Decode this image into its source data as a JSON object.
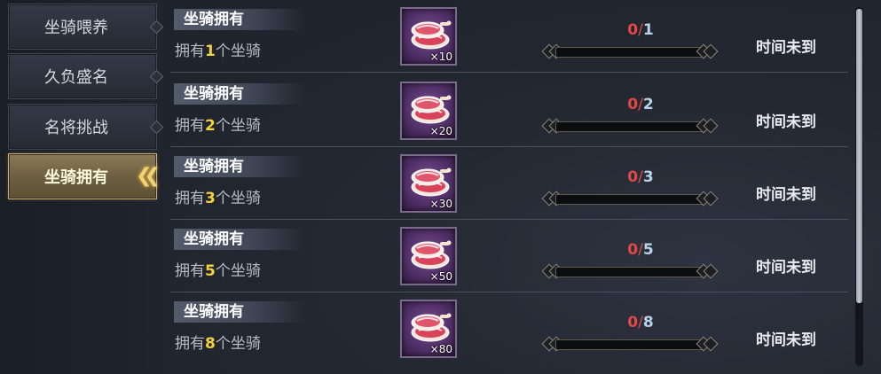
{
  "sidebar": {
    "tabs": [
      {
        "label": "坐骑喂养",
        "active": false
      },
      {
        "label": "久负盛名",
        "active": false
      },
      {
        "label": "名将挑战",
        "active": false
      },
      {
        "label": "坐骑拥有",
        "active": true
      }
    ],
    "active_indicator_icon": "double-chevron-left-icon"
  },
  "tasks": [
    {
      "title": "坐骑拥有",
      "desc_prefix": "拥有",
      "desc_num": "1",
      "desc_suffix": "个坐骑",
      "reward_icon": "meat-icon",
      "reward_qty": "×10",
      "progress_current": "0",
      "progress_sep": "/",
      "progress_total": "1",
      "progress_fraction": 0,
      "status": "时间未到"
    },
    {
      "title": "坐骑拥有",
      "desc_prefix": "拥有",
      "desc_num": "2",
      "desc_suffix": "个坐骑",
      "reward_icon": "meat-icon",
      "reward_qty": "×20",
      "progress_current": "0",
      "progress_sep": "/",
      "progress_total": "2",
      "progress_fraction": 0,
      "status": "时间未到"
    },
    {
      "title": "坐骑拥有",
      "desc_prefix": "拥有",
      "desc_num": "3",
      "desc_suffix": "个坐骑",
      "reward_icon": "meat-icon",
      "reward_qty": "×30",
      "progress_current": "0",
      "progress_sep": "/",
      "progress_total": "3",
      "progress_fraction": 0,
      "status": "时间未到"
    },
    {
      "title": "坐骑拥有",
      "desc_prefix": "拥有",
      "desc_num": "5",
      "desc_suffix": "个坐骑",
      "reward_icon": "meat-icon",
      "reward_qty": "×50",
      "progress_current": "0",
      "progress_sep": "/",
      "progress_total": "5",
      "progress_fraction": 0,
      "status": "时间未到"
    },
    {
      "title": "坐骑拥有",
      "desc_prefix": "拥有",
      "desc_num": "8",
      "desc_suffix": "个坐骑",
      "reward_icon": "meat-icon",
      "reward_qty": "×80",
      "progress_current": "0",
      "progress_sep": "/",
      "progress_total": "8",
      "progress_fraction": 0,
      "status": "时间未到"
    }
  ],
  "colors": {
    "highlight_number": "#f4d23c",
    "progress_current": "#e14848",
    "progress_total": "#b9d3ec",
    "active_tab": "#6b5d3f",
    "item_frame": "#4f2e66"
  }
}
